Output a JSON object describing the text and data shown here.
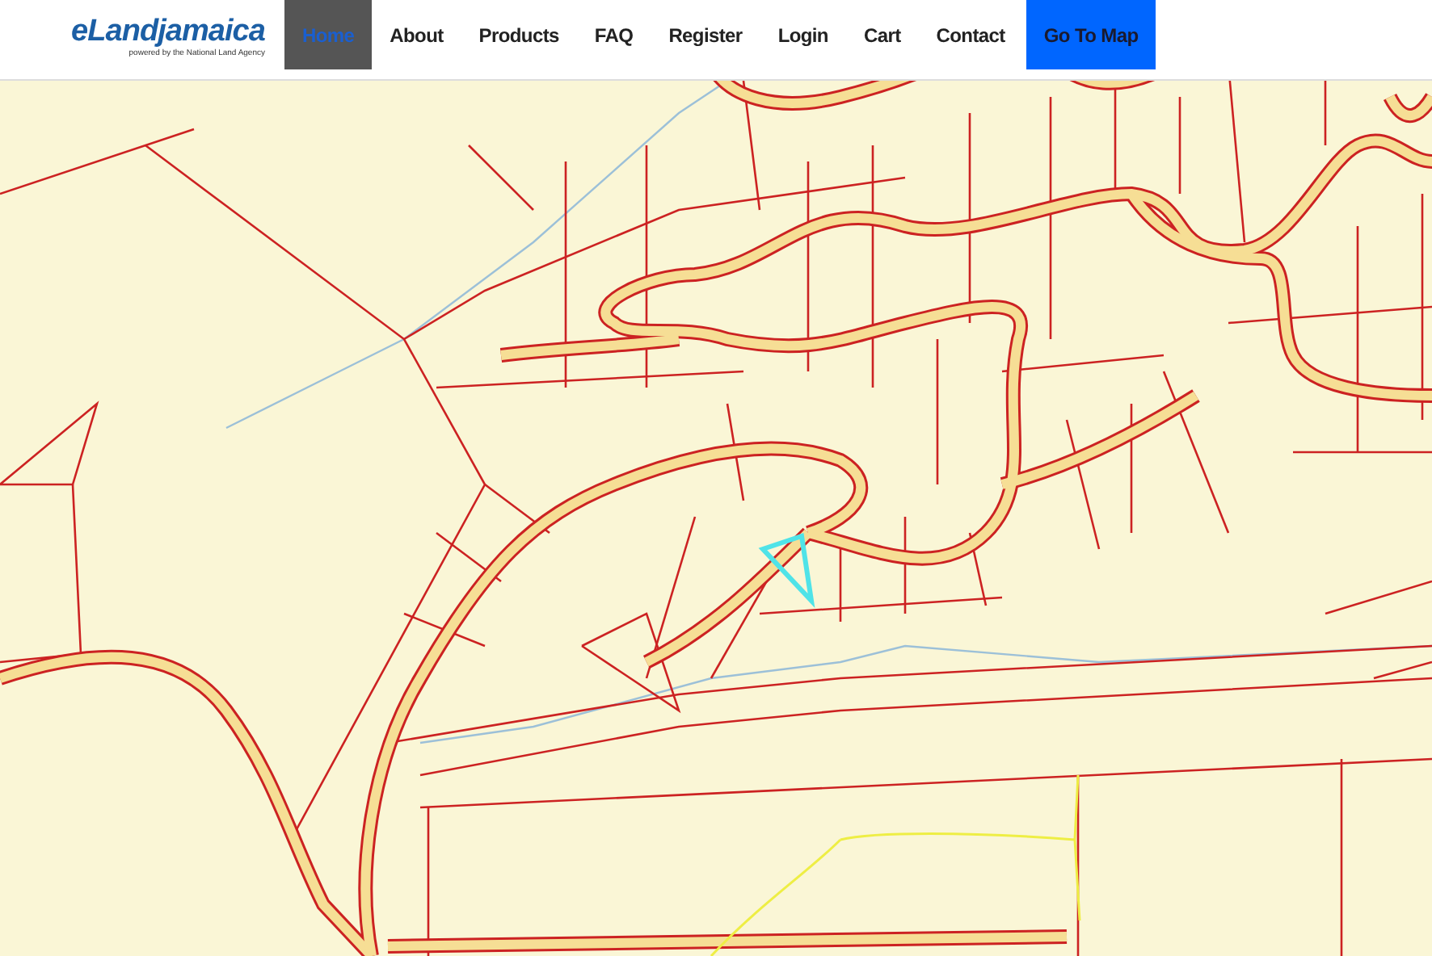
{
  "logo": {
    "name": "eLandjamaica",
    "tagline": "powered by the National Land Agency"
  },
  "nav": [
    {
      "label": "Home",
      "selected": true,
      "kind": "link"
    },
    {
      "label": "About",
      "selected": false,
      "kind": "link"
    },
    {
      "label": "Products",
      "selected": false,
      "kind": "link"
    },
    {
      "label": "FAQ",
      "selected": false,
      "kind": "link"
    },
    {
      "label": "Register",
      "selected": false,
      "kind": "link"
    },
    {
      "label": "Login",
      "selected": false,
      "kind": "link"
    },
    {
      "label": "Cart",
      "selected": false,
      "kind": "link"
    },
    {
      "label": "Contact",
      "selected": false,
      "kind": "link"
    },
    {
      "label": "Go To Map",
      "selected": false,
      "kind": "cta"
    }
  ]
}
